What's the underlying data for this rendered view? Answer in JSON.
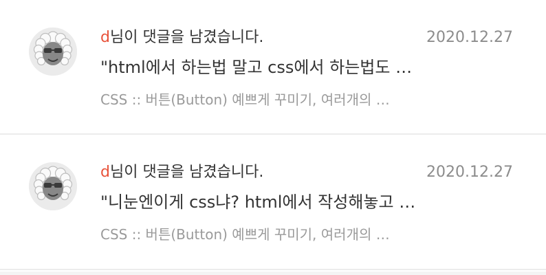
{
  "notifications": [
    {
      "user": "d",
      "action": "님이 댓글을 남겼습니다.",
      "date": "2020.12.27",
      "comment": "\"html에서 하는법 말고 css에서 하는법도 …",
      "post": "CSS :: 버튼(Button) 예쁘게 꾸미기, 여러개의 …",
      "avatar_icon": "afro-sunglasses-avatar-icon"
    },
    {
      "user": "d",
      "action": "님이 댓글을 남겼습니다.",
      "date": "2020.12.27",
      "comment": "\"니눈엔이게 css냐? html에서 작성해놓고 …",
      "post": "CSS :: 버튼(Button) 예쁘게 꾸미기, 여러개의 …",
      "avatar_icon": "afro-sunglasses-avatar-icon"
    }
  ],
  "colors": {
    "accent": "#e8523a",
    "text": "#333333",
    "muted": "#9a9a9a",
    "date": "#8c8c8c",
    "divider": "#ececec"
  }
}
